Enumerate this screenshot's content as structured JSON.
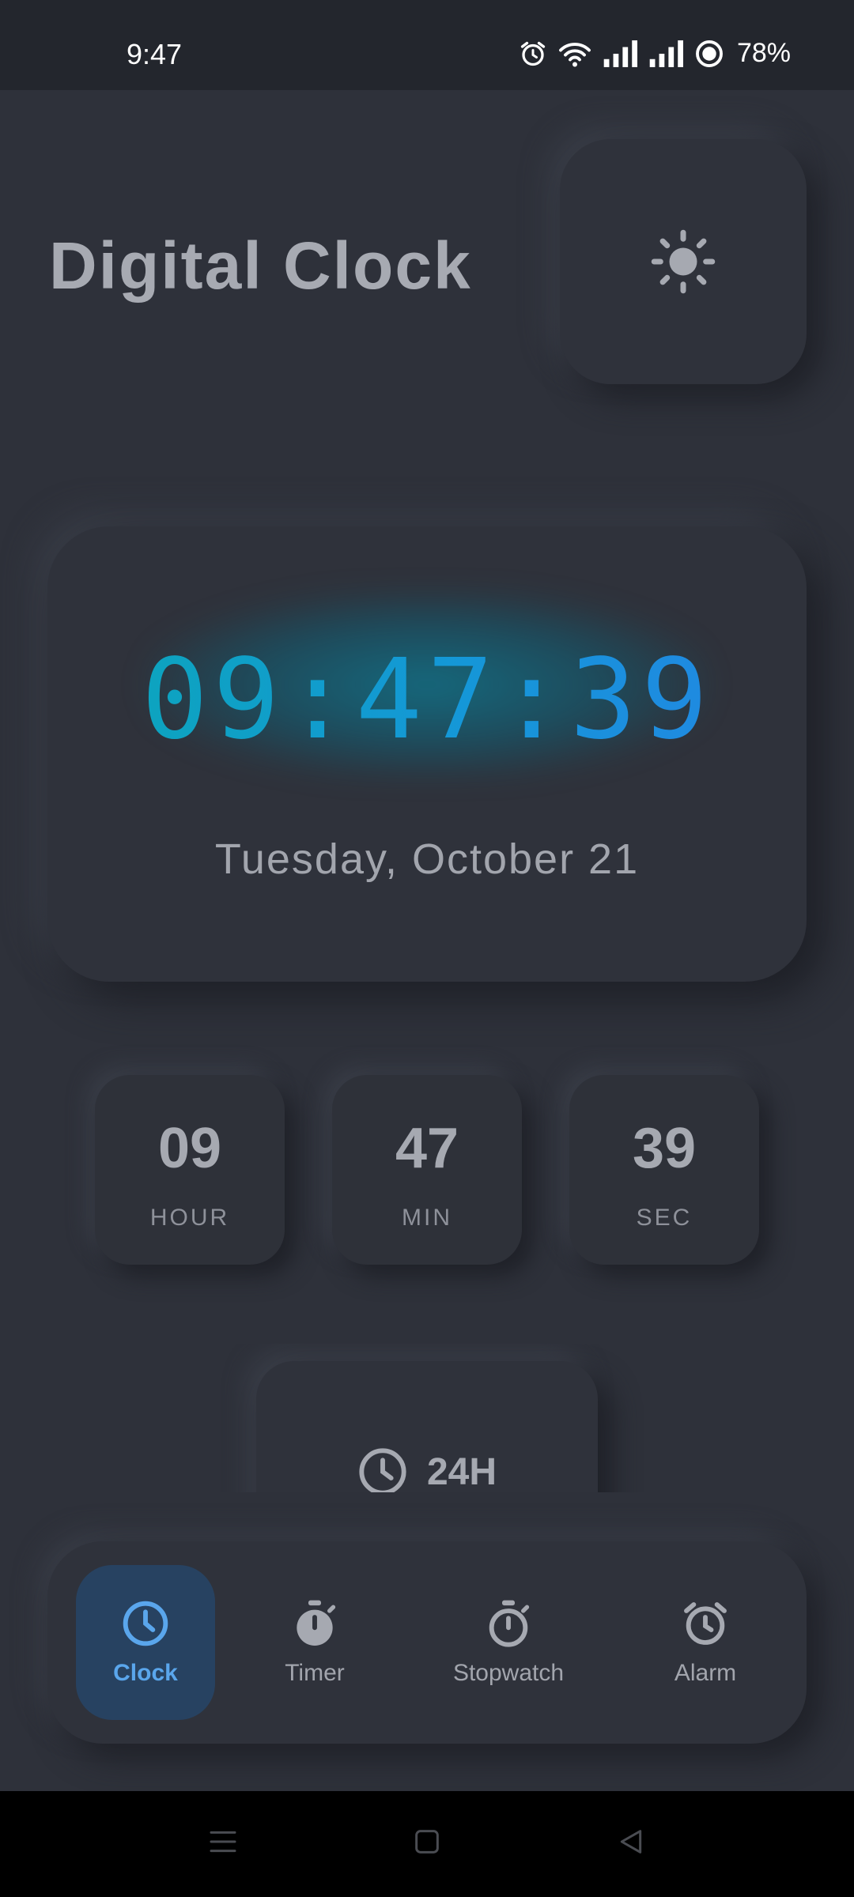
{
  "status_bar": {
    "time": "9:47",
    "battery": "78%",
    "icons": [
      "alarm-icon",
      "wifi-icon",
      "signal-icon",
      "signal-icon",
      "battery-icon"
    ]
  },
  "header": {
    "title": "Digital Clock",
    "theme_icon": "sun-icon"
  },
  "clock": {
    "time": "09:47:39",
    "date": "Tuesday, October 21",
    "accent_colors": [
      "#0aa7b8",
      "#2385e4"
    ]
  },
  "units": [
    {
      "value": "09",
      "label": "HOUR"
    },
    {
      "value": "47",
      "label": "MIN"
    },
    {
      "value": "39",
      "label": "SEC"
    }
  ],
  "format_toggle": {
    "label": "24H",
    "icon": "clock-icon"
  },
  "bottom_nav": {
    "items": [
      {
        "label": "Clock",
        "icon": "clock-icon",
        "active": true
      },
      {
        "label": "Timer",
        "icon": "timer-icon",
        "active": false
      },
      {
        "label": "Stopwatch",
        "icon": "stopwatch-icon",
        "active": false
      },
      {
        "label": "Alarm",
        "icon": "alarm-icon",
        "active": false
      }
    ],
    "active_color": "#5aa6ec"
  },
  "system_nav": [
    "menu-icon",
    "home-icon",
    "back-icon"
  ]
}
